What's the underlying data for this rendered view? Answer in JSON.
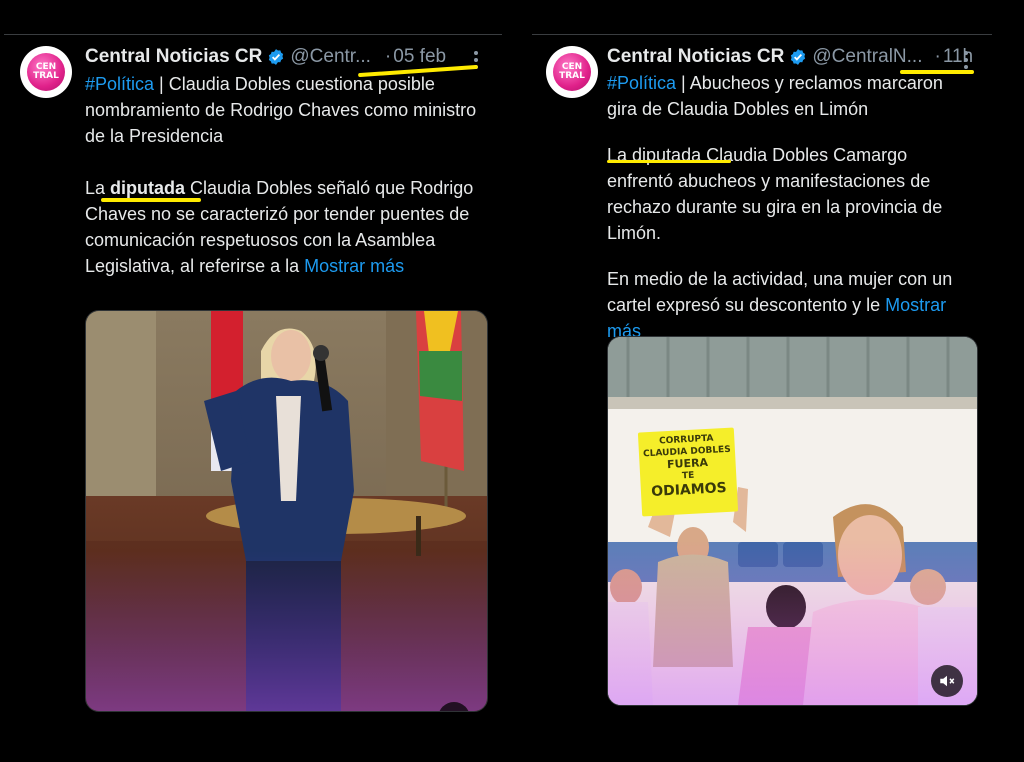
{
  "tweets": [
    {
      "account_name": "Central Noticias CR",
      "handle": "@Centr...",
      "separator": "·",
      "date": "05 feb",
      "avatar_text_top": "CEN",
      "avatar_text_bottom": "TRAL",
      "hashtag": "#Política",
      "headline": " | Claudia Dobles cuestiona posible nombramiento de Rodrigo Chaves como ministro de la Presidencia",
      "para_prefix": "La ",
      "para_bold": "diputada",
      "para_rest": " Claudia Dobles señaló que Rodrigo Chaves no se caracterizó por tender puentes de comunicación respetuosos con la Asamblea Legislativa, al referirse a la ",
      "show_more": "Mostrar más"
    },
    {
      "account_name": "Central Noticias CR",
      "handle": "@CentralN...",
      "separator": "·",
      "date": "11h",
      "avatar_text_top": "CEN",
      "avatar_text_bottom": "TRAL",
      "hashtag": "#Política",
      "headline": " | Abucheos y reclamos marcaron gira de Claudia Dobles en Limón",
      "para1": "La diputada Claudia Dobles Camargo enfrentó abucheos y manifestaciones de rechazo durante su gira en la provincia de Limón.",
      "para2_text": "En medio de la actividad, una mujer con un cartel expresó su descontento y le ",
      "show_more": "Mostrar más",
      "sign_lines": [
        "CORRUPTA",
        "CLAUDIA DOBLES",
        "FUERA",
        "TE",
        "ODIAMOS"
      ]
    }
  ],
  "colors": {
    "background": "#000000",
    "link": "#1d9bf0",
    "highlight": "#ffeb00",
    "verified": "#1d9bf0",
    "avatar": "#e0218a"
  },
  "icons": [
    "verified-badge-icon",
    "more-options-icon",
    "muted-audio-icon"
  ]
}
